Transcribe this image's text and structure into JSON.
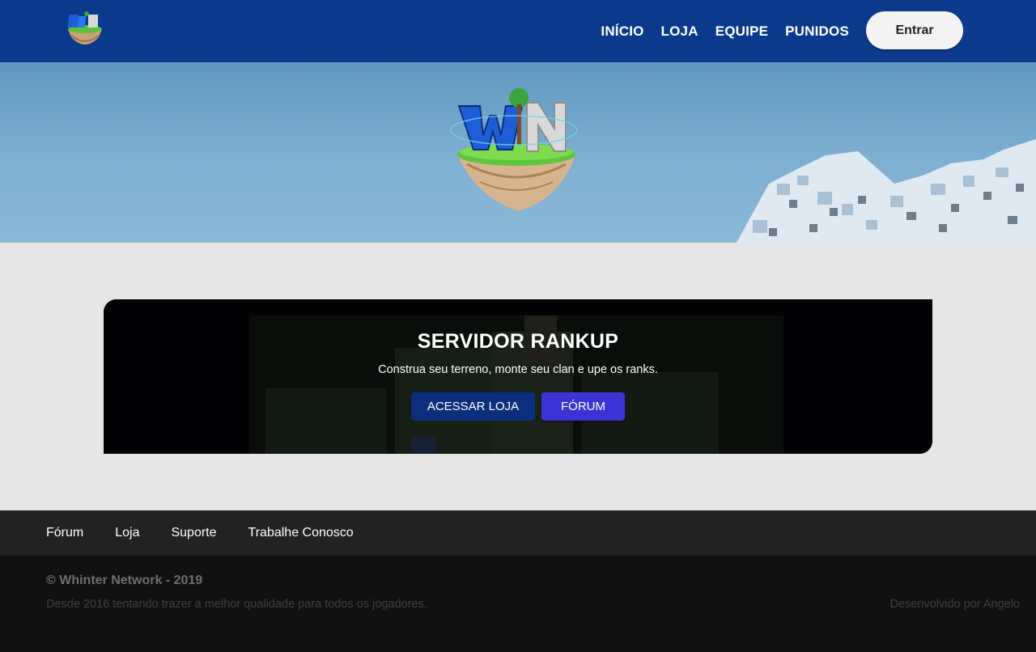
{
  "navbar": {
    "logo_icon": "whinter-logo-icon",
    "links": [
      "INÍCIO",
      "LOJA",
      "EQUIPE",
      "PUNIDOS"
    ],
    "login_label": "Entrar",
    "background_color": "#0b3a8c"
  },
  "hero": {
    "logo_icon": "whinter-island-logo-icon"
  },
  "server_card": {
    "title": "SERVIDOR RANKUP",
    "subtitle": "Construa seu terreno, monte seu clan e upe os ranks.",
    "shop_button": "ACESSAR LOJA",
    "forum_button": "FÓRUM"
  },
  "footer": {
    "links": [
      "Fórum",
      "Loja",
      "Suporte",
      "Trabalhe Conosco"
    ],
    "copyright": "© Whinter Network - 2019",
    "tagline": "Desde 2016 tentando trazer a melhor qualidade para todos os jogadores.",
    "developer": "Desenvolvido por Angelo"
  },
  "colors": {
    "accent_blue": "#0b2f7d",
    "forum_purple": "#3a34d4",
    "page_background": "#e6e6e6"
  }
}
